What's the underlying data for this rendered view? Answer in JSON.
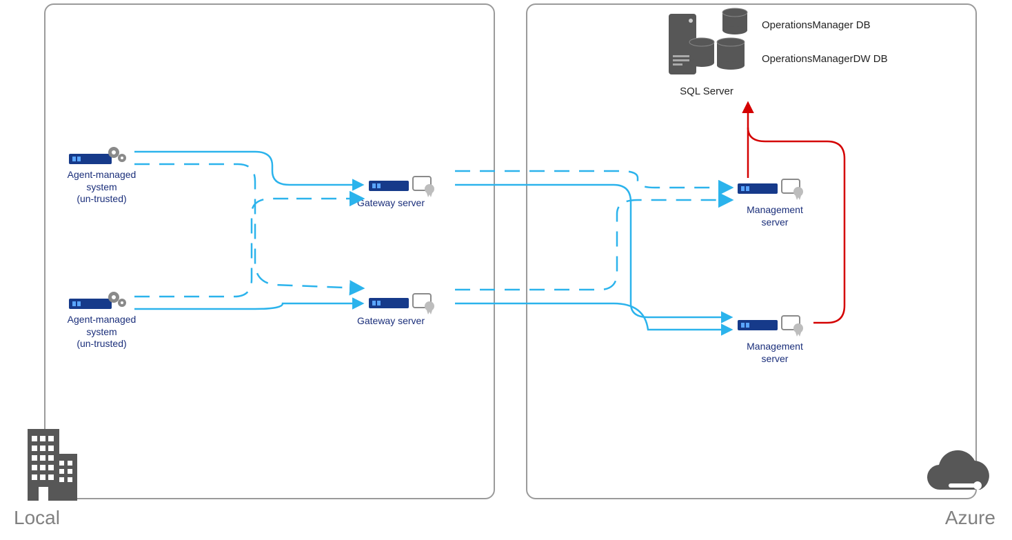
{
  "zones": {
    "local": {
      "label": "Local"
    },
    "azure": {
      "label": "Azure"
    }
  },
  "nodes": {
    "agent1": {
      "label": "Agent-managed\nsystem\n(un-trusted)"
    },
    "agent2": {
      "label": "Agent-managed\nsystem\n(un-trusted)"
    },
    "gateway1": {
      "label": "Gateway server"
    },
    "gateway2": {
      "label": "Gateway server"
    },
    "mgmt1": {
      "label": "Management\nserver"
    },
    "mgmt2": {
      "label": "Management\nserver"
    },
    "sql": {
      "label": "SQL Server"
    },
    "db1": {
      "label": "OperationsManager DB"
    },
    "db2": {
      "label": "OperationsManagerDW DB"
    }
  },
  "colors": {
    "flow": "#2bb3ec",
    "dashed": "#2bb3ec",
    "red": "#d40000",
    "nodeText": "#1a2e7a",
    "zoneBorder": "#9a9a9a",
    "zoneLabel": "#808080",
    "iconGray": "#575757"
  },
  "connections": [
    {
      "from": "agent1",
      "to": "gateway1",
      "style": "solid"
    },
    {
      "from": "agent1",
      "to": "gateway2",
      "style": "dashed"
    },
    {
      "from": "agent2",
      "to": "gateway2",
      "style": "solid"
    },
    {
      "from": "agent2",
      "to": "gateway1",
      "style": "dashed"
    },
    {
      "from": "gateway1",
      "to": "mgmt1",
      "style": "solid"
    },
    {
      "from": "gateway1",
      "to": "mgmt2",
      "style": "solid"
    },
    {
      "from": "gateway2",
      "to": "mgmt2",
      "style": "solid"
    },
    {
      "from": "gateway2",
      "to": "mgmt1",
      "style": "dashed"
    },
    {
      "from": "mgmt1",
      "to": "sql",
      "style": "red"
    },
    {
      "from": "mgmt2",
      "to": "sql",
      "style": "red",
      "via": "mgmt1"
    }
  ]
}
